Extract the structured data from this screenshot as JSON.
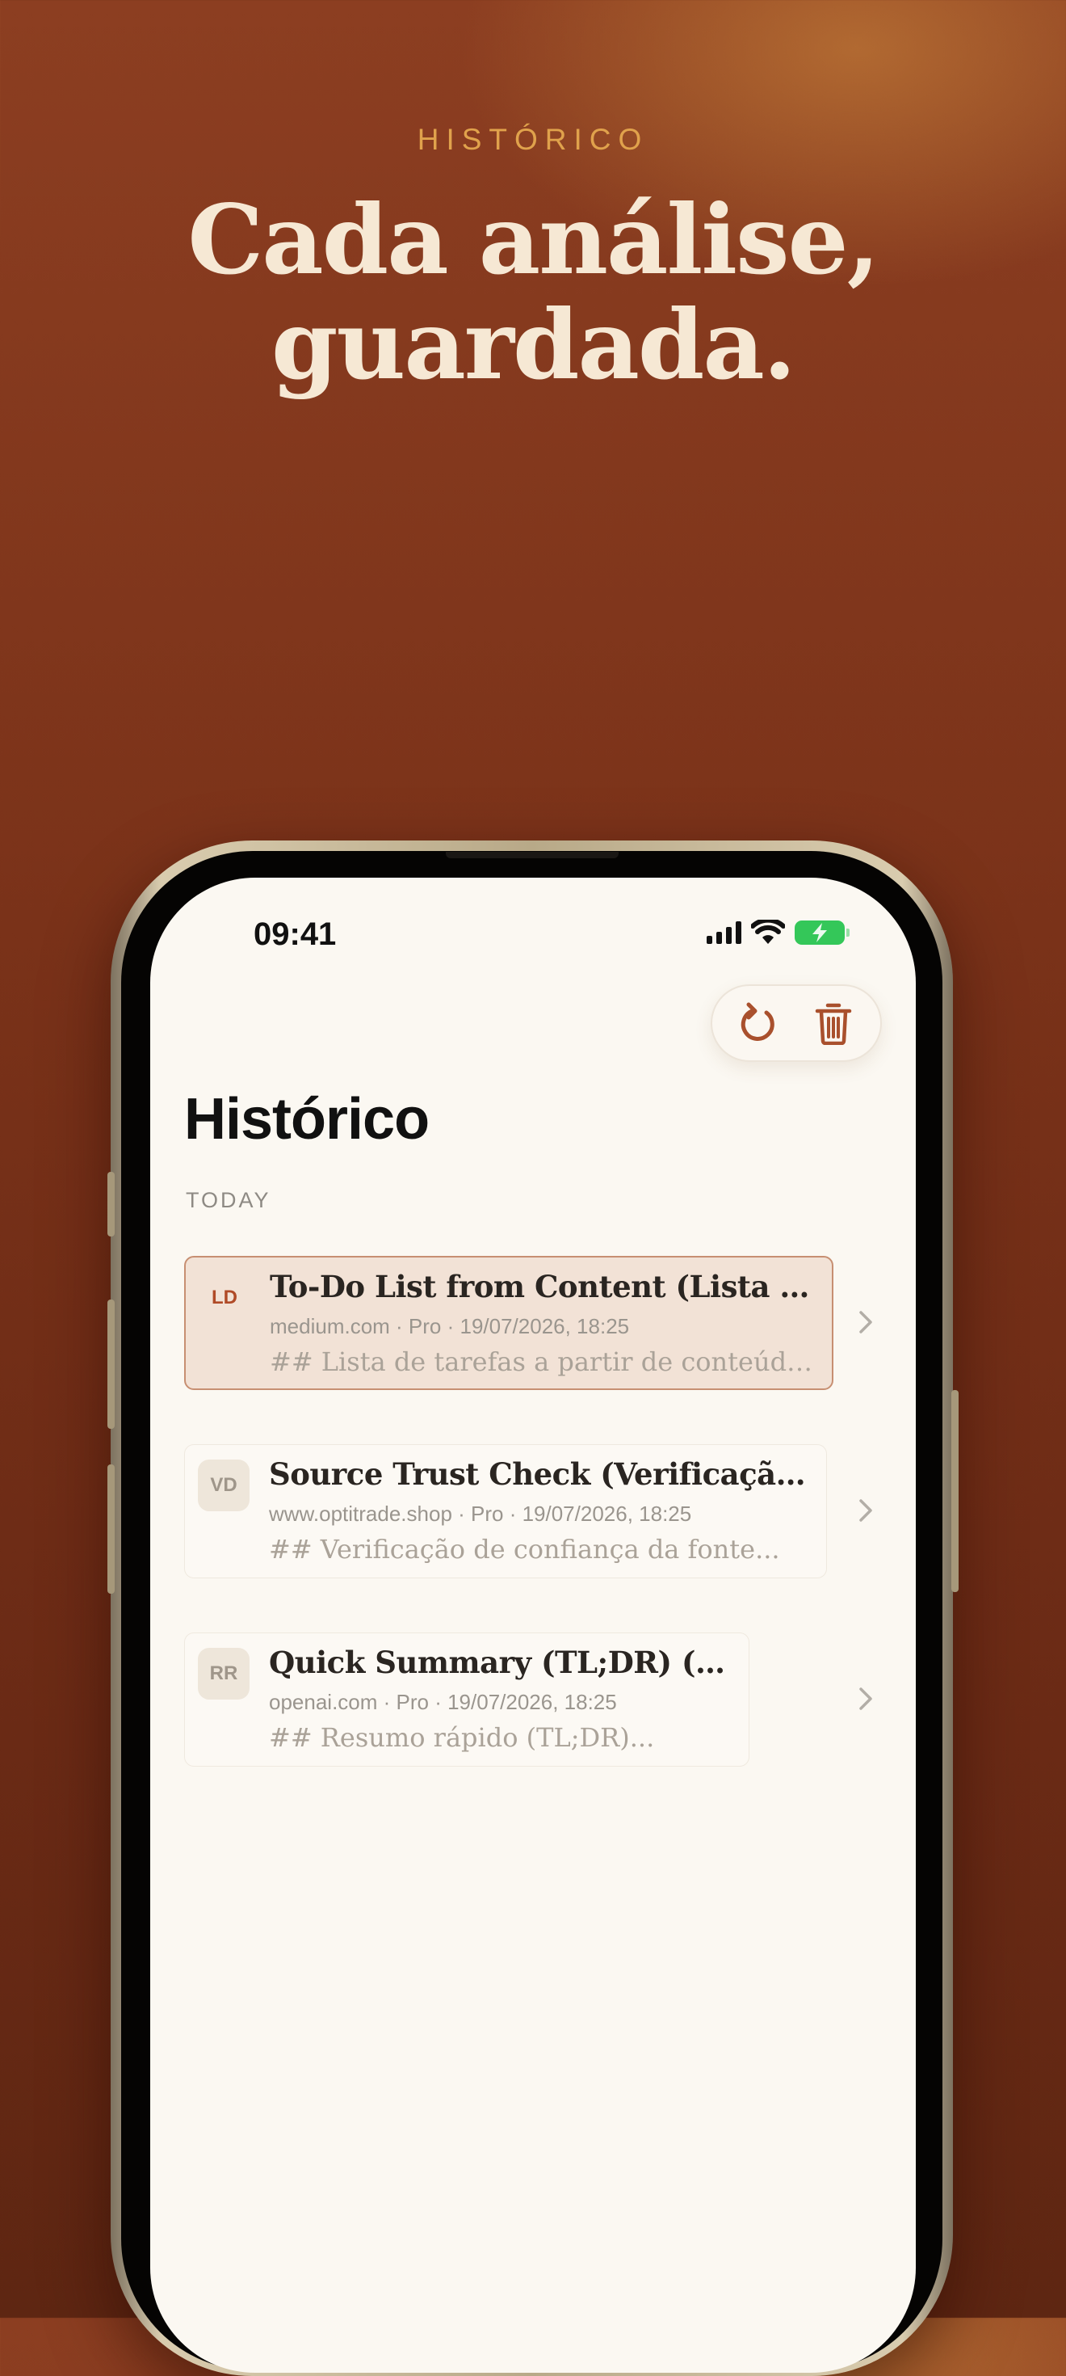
{
  "hero": {
    "eyebrow": "HISTÓRICO",
    "headline_line1": "Cada análise,",
    "headline_line2": "guardada."
  },
  "status_bar": {
    "time": "09:41",
    "icons": [
      "cellular-signal-icon",
      "wifi-icon",
      "battery-charging-icon"
    ],
    "battery_color": "#34c759"
  },
  "toolbar": {
    "actions": [
      {
        "name": "refresh",
        "icon": "refresh-icon"
      },
      {
        "name": "delete",
        "icon": "trash-icon"
      }
    ],
    "icon_color": "#a9502d"
  },
  "page": {
    "title": "Histórico",
    "section_label": "TODAY"
  },
  "history_items": [
    {
      "initials": "LD",
      "title": "To-Do List from Content (Lista de tarefas a partir de conteúdo)",
      "meta": "medium.com · Pro · 19/07/2026, 18:25",
      "preview": "## Lista de tarefas a partir de conteúdo...",
      "selected": true
    },
    {
      "initials": "VD",
      "title": "Source Trust Check (Verificação de confiança da fonte)",
      "meta": "www.optitrade.shop · Pro · 19/07/2026, 18:25",
      "preview": "## Verificação de confiança da fonte...",
      "selected": false
    },
    {
      "initials": "RR",
      "title": "Quick Summary (TL;DR) (TL;DR)",
      "meta": "openai.com · Pro · 19/07/2026, 18:25",
      "preview": "## Resumo rápido (TL;DR)...",
      "selected": false
    }
  ],
  "colors": {
    "background_top": "#8c3e21",
    "background_bottom": "#5e2612",
    "eyebrow": "#e0a24c",
    "headline": "#f6e8d4",
    "selected_card": "#f2e2d6",
    "selected_initials": "#b04a27"
  }
}
